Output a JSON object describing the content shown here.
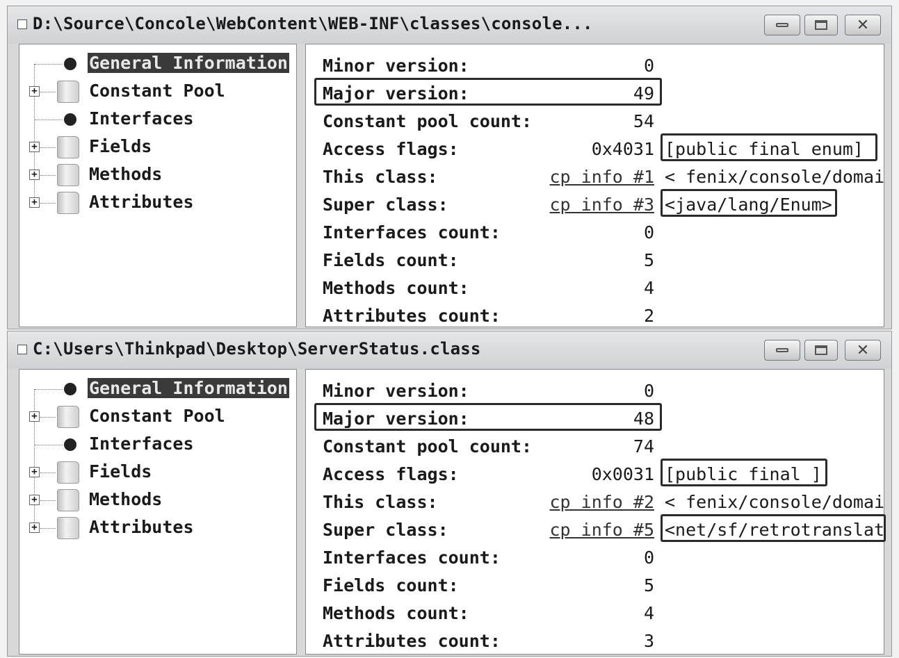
{
  "windows": [
    {
      "title": "D:\\Source\\Concole\\WebContent\\WEB-INF\\classes\\console...",
      "tree": [
        {
          "label": "General Information",
          "icon": "bullet-icon",
          "expandable": false,
          "selected": true
        },
        {
          "label": "Constant Pool",
          "icon": "folder-icon",
          "expandable": true,
          "selected": false
        },
        {
          "label": "Interfaces",
          "icon": "bullet-icon",
          "expandable": false,
          "selected": false
        },
        {
          "label": "Fields",
          "icon": "folder-icon",
          "expandable": true,
          "selected": false
        },
        {
          "label": "Methods",
          "icon": "folder-icon",
          "expandable": true,
          "selected": false
        },
        {
          "label": "Attributes",
          "icon": "folder-icon",
          "expandable": true,
          "selected": false
        }
      ],
      "details": [
        {
          "label": "Minor version:",
          "value": "0"
        },
        {
          "label": "Major version:",
          "value": "49"
        },
        {
          "label": "Constant pool count:",
          "value": "54"
        },
        {
          "label": "Access flags:",
          "value": "0x4031",
          "extra": "[public final  enum]"
        },
        {
          "label": "This class:",
          "value": "cp info #1",
          "link": true,
          "extra": "< fenix/console/domai"
        },
        {
          "label": "Super class:",
          "value": "cp info #3",
          "link": true,
          "extra": "<java/lang/Enum>"
        },
        {
          "label": "Interfaces count:",
          "value": "0"
        },
        {
          "label": "Fields count:",
          "value": "5"
        },
        {
          "label": "Methods count:",
          "value": "4"
        },
        {
          "label": "Attributes count:",
          "value": "2"
        }
      ]
    },
    {
      "title": "C:\\Users\\Thinkpad\\Desktop\\ServerStatus.class",
      "tree": [
        {
          "label": "General Information",
          "icon": "bullet-icon",
          "expandable": false,
          "selected": true
        },
        {
          "label": "Constant Pool",
          "icon": "folder-icon",
          "expandable": true,
          "selected": false
        },
        {
          "label": "Interfaces",
          "icon": "bullet-icon",
          "expandable": false,
          "selected": false
        },
        {
          "label": "Fields",
          "icon": "folder-icon",
          "expandable": true,
          "selected": false
        },
        {
          "label": "Methods",
          "icon": "folder-icon",
          "expandable": true,
          "selected": false
        },
        {
          "label": "Attributes",
          "icon": "folder-icon",
          "expandable": true,
          "selected": false
        }
      ],
      "details": [
        {
          "label": "Minor version:",
          "value": "0"
        },
        {
          "label": "Major version:",
          "value": "48"
        },
        {
          "label": "Constant pool count:",
          "value": "74"
        },
        {
          "label": "Access flags:",
          "value": "0x0031",
          "extra": "[public final ]"
        },
        {
          "label": "This class:",
          "value": "cp info #2",
          "link": true,
          "extra": "< fenix/console/domai"
        },
        {
          "label": "Super class:",
          "value": "cp info #5",
          "link": true,
          "extra": "<net/sf/retrotranslat"
        },
        {
          "label": "Interfaces count:",
          "value": "0"
        },
        {
          "label": "Fields count:",
          "value": "5"
        },
        {
          "label": "Methods count:",
          "value": "4"
        },
        {
          "label": "Attributes count:",
          "value": "3"
        }
      ]
    }
  ]
}
